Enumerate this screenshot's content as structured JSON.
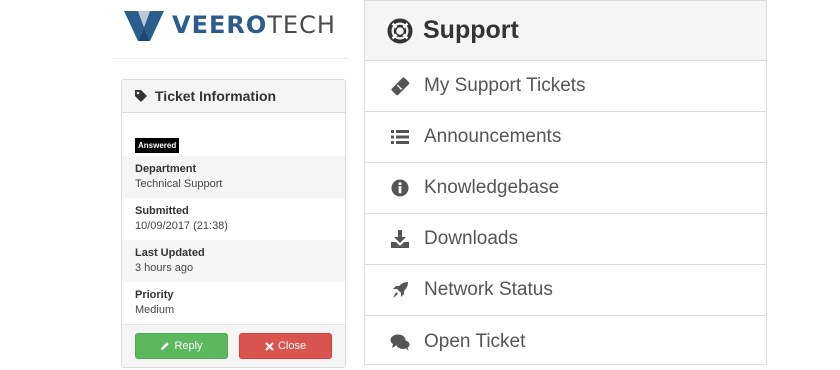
{
  "logo": {
    "part_a": "VEERO",
    "part_b": "TECH"
  },
  "ticket": {
    "title": "Ticket Information",
    "status": "Answered",
    "fields": [
      {
        "label": "Department",
        "value": "Technical Support"
      },
      {
        "label": "Submitted",
        "value": "10/09/2017 (21:38)"
      },
      {
        "label": "Last Updated",
        "value": "3 hours ago"
      },
      {
        "label": "Priority",
        "value": "Medium"
      }
    ],
    "reply_label": "Reply",
    "close_label": "Close"
  },
  "support": {
    "title": "Support",
    "items": [
      {
        "label": "My Support Tickets",
        "icon": "ticket-icon"
      },
      {
        "label": "Announcements",
        "icon": "list-icon"
      },
      {
        "label": "Knowledgebase",
        "icon": "info-circle-icon"
      },
      {
        "label": "Downloads",
        "icon": "download-icon"
      },
      {
        "label": "Network Status",
        "icon": "rocket-icon"
      },
      {
        "label": "Open Ticket",
        "icon": "comments-icon"
      }
    ]
  },
  "colors": {
    "reply": "#5cb85c",
    "close": "#d9534f",
    "logo_primary": "#2a5d8c",
    "status_badge": "#000000"
  }
}
